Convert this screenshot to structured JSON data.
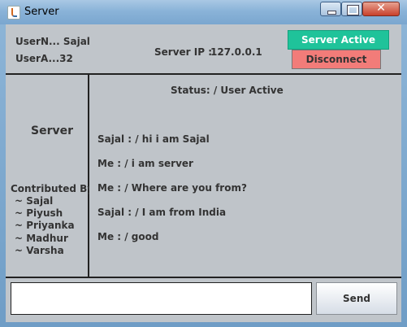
{
  "window": {
    "title": "Server"
  },
  "header": {
    "user_name": "UserN... Sajal",
    "user_address": "UserA...32",
    "server_ip_label": "Server IP :",
    "server_ip_value": "127.0.0.1",
    "server_active_label": "Server Active",
    "disconnect_label": "Disconnect"
  },
  "sidebar": {
    "title": "Server",
    "contributed_by": "Contributed By",
    "contributors": [
      "~ Sajal",
      "~ Piyush",
      "~ Priyanka",
      "~ Madhur",
      "~ Varsha"
    ]
  },
  "chat": {
    "status": "Status: / User Active",
    "messages": [
      "Sajal : / hi i am Sajal",
      "Me : / i am server",
      "Me : / Where are you from?",
      "Sajal : / I am from India",
      "Me : / good"
    ]
  },
  "composer": {
    "input_value": "",
    "send_label": "Send"
  },
  "colors": {
    "server_active": "#1fc39a",
    "disconnect": "#f27c79"
  }
}
